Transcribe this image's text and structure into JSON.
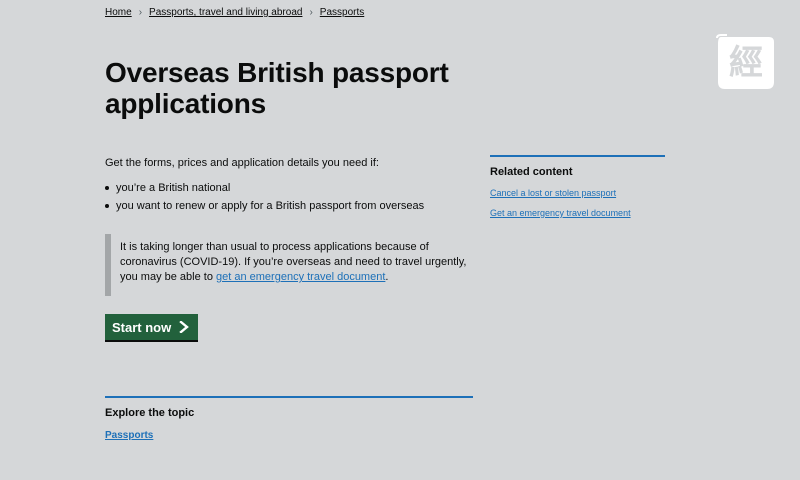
{
  "breadcrumb": {
    "items": [
      "Home",
      "Passports, travel and living abroad",
      "Passports"
    ],
    "separator": "›"
  },
  "page": {
    "title": "Overseas British passport applications",
    "intro": "Get the forms, prices and application details you need if:",
    "bullets": [
      "you’re a British national",
      "you want to renew or apply for a British passport from overseas"
    ]
  },
  "inset": {
    "text_before": "It is taking longer than usual to process applications because of coronavirus (COVID-19). If you’re overseas and need to travel urgently, you may be able to ",
    "link": "get an emergency travel document",
    "text_after": "."
  },
  "start_button": {
    "label": "Start now",
    "icon": "chevron-right-icon"
  },
  "explore": {
    "heading": "Explore the topic",
    "link": "Passports"
  },
  "related": {
    "heading": "Related content",
    "links": [
      "Cancel a lost or stolen passport",
      "Get an emergency travel document"
    ]
  },
  "watermark": {
    "glyph": "經"
  },
  "colors": {
    "background": "#d5d7d9",
    "link": "#1d70b8",
    "start_button": "#22613c",
    "rule": "#1d70b8",
    "inset_border": "#a3a6a8"
  }
}
